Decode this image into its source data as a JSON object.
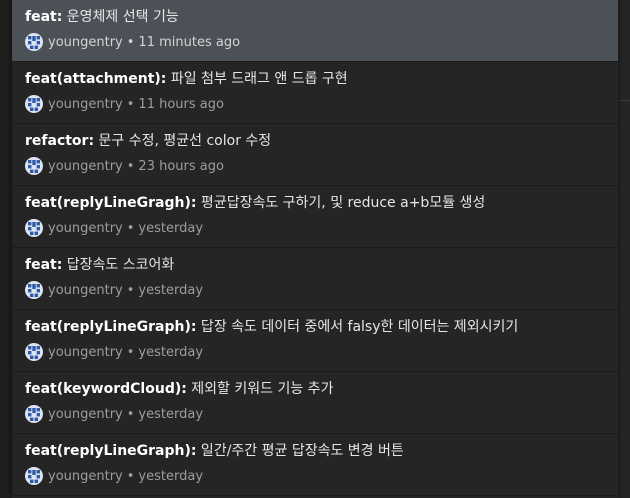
{
  "commits": [
    {
      "prefix": "feat:",
      "message": " 운영체제 선택 기능",
      "author": "youngentry",
      "separator": "•",
      "time": "11 minutes ago",
      "selected": true
    },
    {
      "prefix": "feat(attachment):",
      "message": " 파일 첨부 드래그 앤 드롭 구현",
      "author": "youngentry",
      "separator": "•",
      "time": "11 hours ago",
      "selected": false
    },
    {
      "prefix": "refactor:",
      "message": " 문구 수정, 평균선 color 수정",
      "author": "youngentry",
      "separator": "•",
      "time": "23 hours ago",
      "selected": false
    },
    {
      "prefix": "feat(replyLineGragh):",
      "message": " 평균답장속도 구하기, 및 reduce a+b모듈 생성",
      "author": "youngentry",
      "separator": "•",
      "time": "yesterday",
      "selected": false
    },
    {
      "prefix": "feat:",
      "message": " 답장속도 스코어화",
      "author": "youngentry",
      "separator": "•",
      "time": "yesterday",
      "selected": false
    },
    {
      "prefix": "feat(replyLineGraph):",
      "message": " 답장 속도 데이터 중에서 falsy한 데이터는 제외시키기",
      "author": "youngentry",
      "separator": "•",
      "time": "yesterday",
      "selected": false
    },
    {
      "prefix": "feat(keywordCloud):",
      "message": " 제외할 키워드 기능 추가",
      "author": "youngentry",
      "separator": "•",
      "time": "yesterday",
      "selected": false
    },
    {
      "prefix": "feat(replyLineGraph):",
      "message": " 일간/주간 평균 답장속도 변경 버튼",
      "author": "youngentry",
      "separator": "•",
      "time": "yesterday",
      "selected": false
    }
  ],
  "colors": {
    "panel_bg": "#252526",
    "selected_bg": "#4c5158",
    "text": "#e6e6e6",
    "meta_text": "#9d9d9d"
  },
  "icons": {
    "avatar": "avatar-identicon-icon"
  }
}
